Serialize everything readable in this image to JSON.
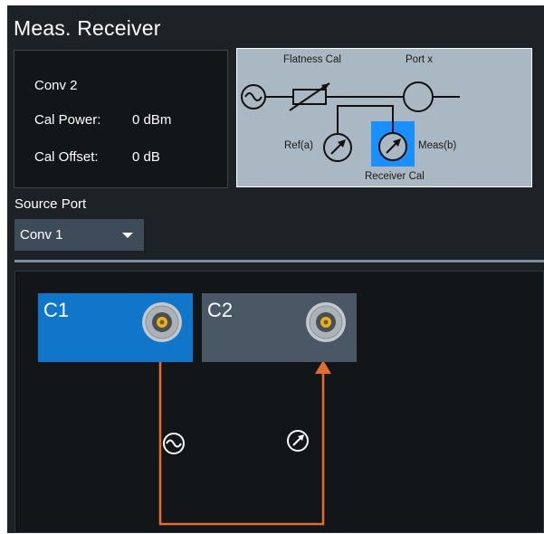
{
  "header": {
    "title": "Meas. Receiver"
  },
  "info": {
    "converter": "Conv 2",
    "cal_power_label": "Cal Power:",
    "cal_power_value": "0 dBm",
    "cal_offset_label": "Cal Offset:",
    "cal_offset_value": "0 dB"
  },
  "schematic": {
    "flatness_cal": "Flatness Cal",
    "port_x": "Port x",
    "ref_a": "Ref(a)",
    "meas_b": "Meas(b)",
    "receiver_cal": "Receiver Cal",
    "highlight_color": "#1a8fff"
  },
  "source_port": {
    "label": "Source Port",
    "selected": "Conv 1"
  },
  "ports": {
    "c1": {
      "label": "C1",
      "role": "source",
      "color": "#0f76c9"
    },
    "c2": {
      "label": "C2",
      "role": "receiver",
      "color": "#4a5866"
    }
  },
  "connection": {
    "line_color": "#e36e2c",
    "source_icon": "generator-icon",
    "receiver_icon": "meter-icon"
  }
}
